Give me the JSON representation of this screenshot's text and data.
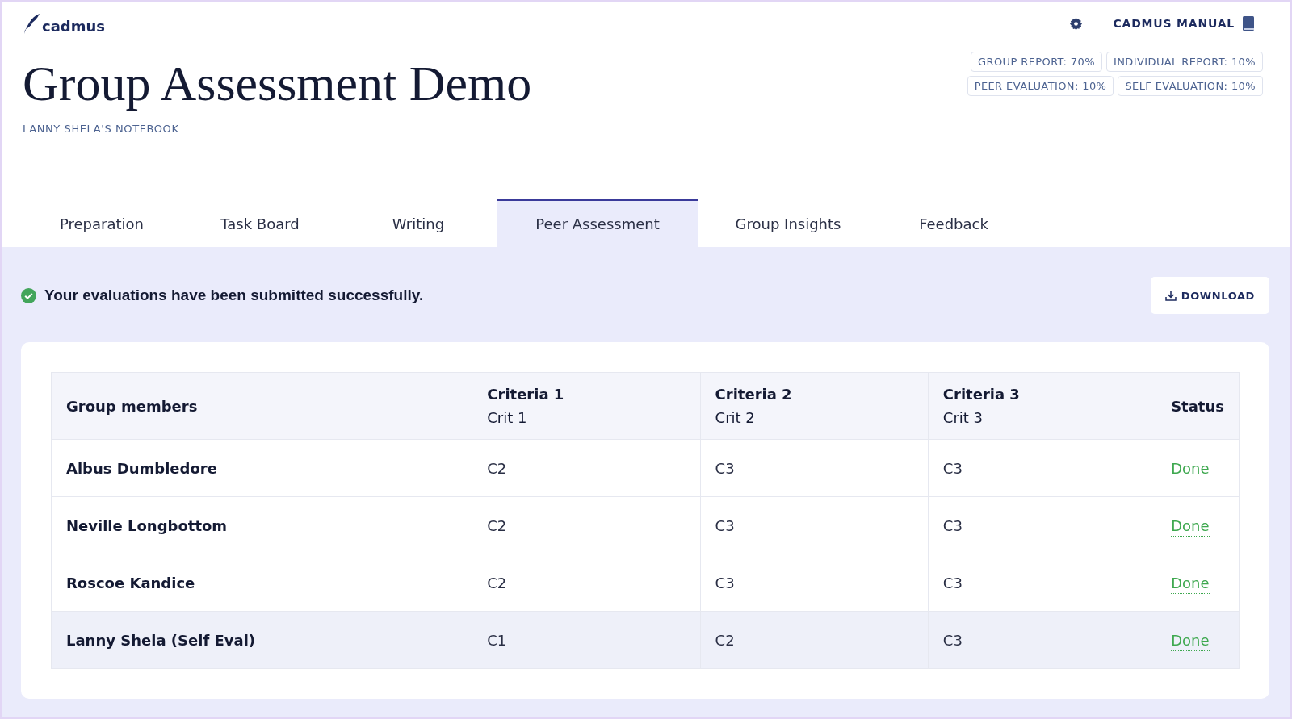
{
  "header": {
    "logo": "cadmus",
    "manual_link": "CADMUS MANUAL",
    "title": "Group Assessment Demo",
    "subtitle": "LANNY SHELA'S NOTEBOOK",
    "weights": [
      "GROUP REPORT: 70%",
      "INDIVIDUAL REPORT: 10%",
      "PEER EVALUATION: 10%",
      "SELF EVALUATION: 10%"
    ]
  },
  "tabs": [
    {
      "label": "Preparation",
      "selected": false
    },
    {
      "label": "Task Board",
      "selected": false
    },
    {
      "label": "Writing",
      "selected": false
    },
    {
      "label": "Peer Assessment",
      "selected": true
    },
    {
      "label": "Group Insights",
      "selected": false
    },
    {
      "label": "Feedback",
      "selected": false
    }
  ],
  "message": "Your evaluations have been submitted successfully.",
  "download_button": "DOWNLOAD",
  "table": {
    "columns": [
      {
        "title": "Group members"
      },
      {
        "title": "Criteria 1",
        "subtitle": "Crit 1"
      },
      {
        "title": "Criteria 2",
        "subtitle": "Crit 2"
      },
      {
        "title": "Criteria 3",
        "subtitle": "Crit 3"
      },
      {
        "title": "Status"
      }
    ],
    "rows": [
      {
        "member": "Albus Dumbledore",
        "scores": [
          "C2",
          "C3",
          "C3"
        ],
        "status": "Done",
        "highlighted": false
      },
      {
        "member": "Neville Longbottom",
        "scores": [
          "C2",
          "C3",
          "C3"
        ],
        "status": "Done",
        "highlighted": false
      },
      {
        "member": "Roscoe Kandice",
        "scores": [
          "C2",
          "C3",
          "C3"
        ],
        "status": "Done",
        "highlighted": false
      },
      {
        "member": "Lanny Shela (Self Eval)",
        "scores": [
          "C1",
          "C2",
          "C3"
        ],
        "status": "Done",
        "highlighted": true
      }
    ]
  }
}
